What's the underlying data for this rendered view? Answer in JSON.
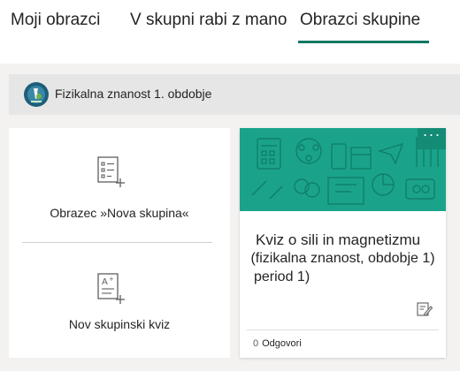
{
  "tabs": [
    {
      "label": "Moji obrazci",
      "active": false
    },
    {
      "label": "V skupni rabi z mano",
      "active": false
    },
    {
      "label": "Obrazci skupine",
      "active": true
    }
  ],
  "accent_color": "#117865",
  "group": {
    "name": "Fizikalna znanost 1. obdobje",
    "avatar_icon": "microscope-icon"
  },
  "new_actions": {
    "new_group_form_label": "Obrazec »Nova skupina«",
    "new_group_form_icon": "form-add-icon",
    "new_group_quiz_label": "Nov skupinski kviz",
    "new_group_quiz_icon": "quiz-add-icon"
  },
  "form_card": {
    "banner_color": "#1aa38a",
    "more_label": "···",
    "title_line1": "Kviz o sili in magnetizmu",
    "title_line2": "(fizikalna znanost, obdobje 1)",
    "title_line3": "period 1)",
    "edit_icon": "edit-icon",
    "responses_count": "0",
    "responses_label": "Odgovori"
  }
}
